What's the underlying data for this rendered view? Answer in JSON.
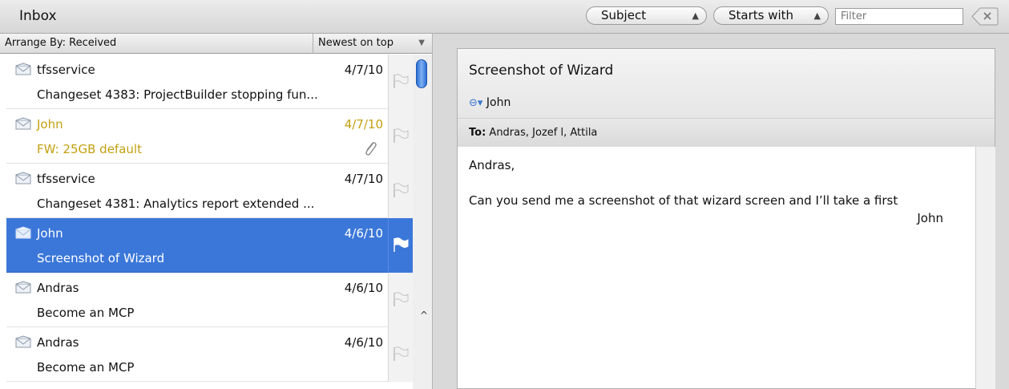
{
  "header": {
    "title": "Inbox",
    "search_field": "Subject",
    "search_mode": "Starts with",
    "filter_placeholder": "Filter"
  },
  "arrange": {
    "by_label": "Arrange By: Received",
    "order_label": "Newest on top"
  },
  "messages": [
    {
      "sender": "tfsservice",
      "date": "4/7/10",
      "subject": "Changeset 4383: ProjectBuilder stopping fun..."
    },
    {
      "sender": "John",
      "date": "4/7/10",
      "subject": "FW: 25GB default",
      "attachment": true
    },
    {
      "sender": "tfsservice",
      "date": "4/7/10",
      "subject": "Changeset 4381: Analytics report extended ..."
    },
    {
      "sender": "John",
      "date": "4/6/10",
      "subject": "Screenshot of Wizard",
      "selected": true
    },
    {
      "sender": "Andras",
      "date": "4/6/10",
      "subject": "Become an MCP"
    },
    {
      "sender": "Andras",
      "date": "4/6/10",
      "subject": "Become an MCP"
    }
  ],
  "reading": {
    "subject": "Screenshot of Wizard",
    "from": "John",
    "to_label": "To:",
    "to": "Andras, Jozef l, Attila",
    "greeting": "Andras,",
    "body": "Can you send me a screenshot of that wizard screen and I’ll take a first",
    "signer": "John"
  },
  "colors": {
    "selection": "#3b77d9",
    "flagged_text": "#c4a011"
  }
}
